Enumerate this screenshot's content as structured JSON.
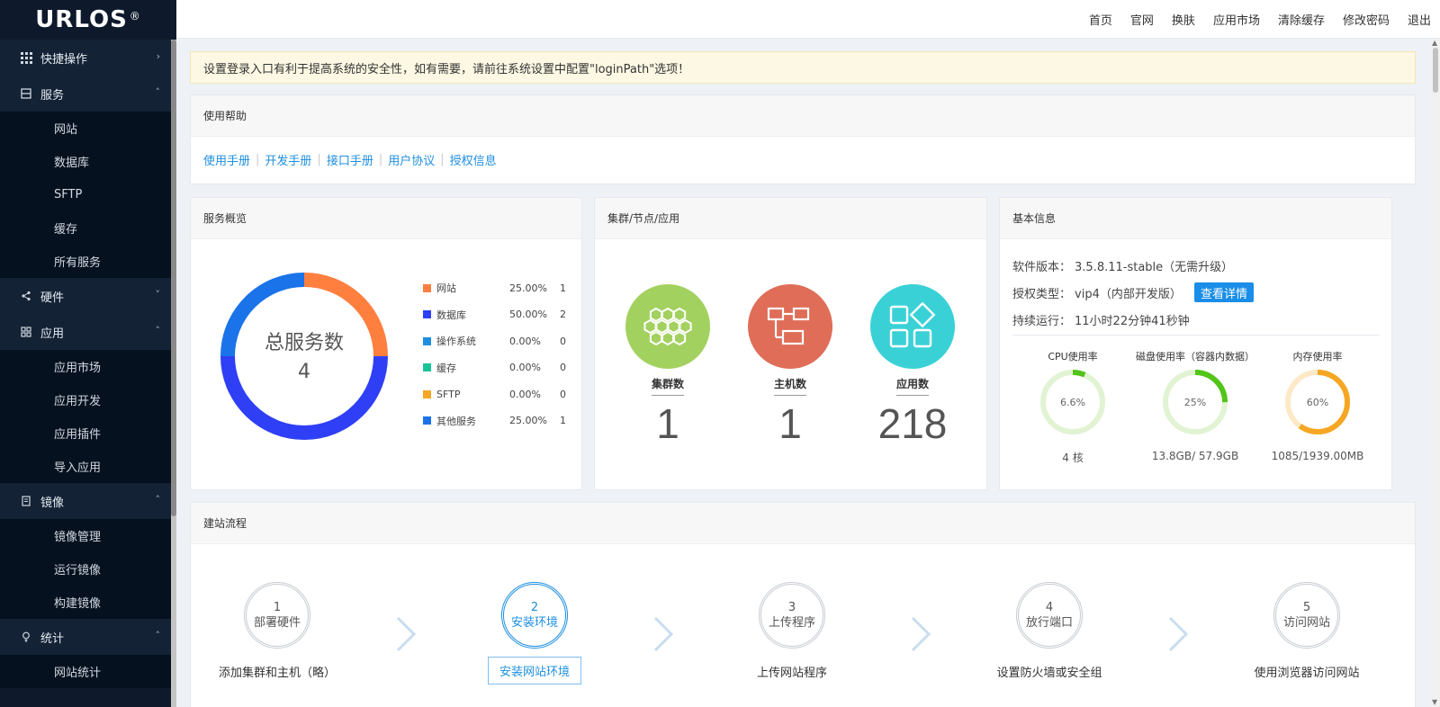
{
  "brand": {
    "name": "URLOS",
    "mark": "®"
  },
  "sidebar": {
    "groups": [
      {
        "label": "快捷操作",
        "icon": "grid-icon",
        "arrow": "›",
        "items": []
      },
      {
        "label": "服务",
        "icon": "server-icon",
        "arrow": "˄",
        "items": [
          "网站",
          "数据库",
          "SFTP",
          "缓存",
          "所有服务"
        ]
      },
      {
        "label": "硬件",
        "icon": "share-nodes-icon",
        "arrow": "˅",
        "items": []
      },
      {
        "label": "应用",
        "icon": "apps-icon",
        "arrow": "˄",
        "items": [
          "应用市场",
          "应用开发",
          "应用插件",
          "导入应用"
        ]
      },
      {
        "label": "镜像",
        "icon": "document-icon",
        "arrow": "˄",
        "items": [
          "镜像管理",
          "运行镜像",
          "构建镜像"
        ]
      },
      {
        "label": "统计",
        "icon": "lightbulb-icon",
        "arrow": "˄",
        "items": [
          "网站统计"
        ]
      }
    ]
  },
  "topnav": [
    "首页",
    "官网",
    "换肤",
    "应用市场",
    "清除缓存",
    "修改密码",
    "退出"
  ],
  "alert": "设置登录入口有利于提高系统的安全性，如有需要，请前往系统设置中配置\"loginPath\"选项！",
  "help": {
    "title": "使用帮助",
    "links": [
      "使用手册",
      "开发手册",
      "接口手册",
      "用户协议",
      "授权信息"
    ]
  },
  "services": {
    "title": "服务概览",
    "center_label": "总服务数",
    "total": "4",
    "legend": [
      {
        "name": "网站",
        "pct": "25.00%",
        "count": "1",
        "color": "#ff7f3f",
        "value": 1
      },
      {
        "name": "数据库",
        "pct": "50.00%",
        "count": "2",
        "color": "#2f3ff5",
        "value": 2
      },
      {
        "name": "操作系统",
        "pct": "0.00%",
        "count": "0",
        "color": "#1e8fe0",
        "value": 0
      },
      {
        "name": "缓存",
        "pct": "0.00%",
        "count": "0",
        "color": "#19c39a",
        "value": 0
      },
      {
        "name": "SFTP",
        "pct": "0.00%",
        "count": "0",
        "color": "#f5a623",
        "value": 0
      },
      {
        "name": "其他服务",
        "pct": "25.00%",
        "count": "1",
        "color": "#1a73e8",
        "value": 1
      }
    ]
  },
  "nodes": {
    "title": "集群/节点/应用",
    "stats": [
      {
        "label": "集群数",
        "value": "1",
        "color": "#a3d160",
        "icon": "honeycomb-icon"
      },
      {
        "label": "主机数",
        "value": "1",
        "color": "#df6d57",
        "icon": "network-hosts-icon"
      },
      {
        "label": "应用数",
        "value": "218",
        "color": "#3ad1d6",
        "icon": "app-shapes-icon"
      }
    ]
  },
  "info": {
    "title": "基本信息",
    "version_label": "软件版本：",
    "version": "3.5.8.11-stable（无需升级）",
    "license_label": "授权类型：",
    "license": "vip4（内部开发版）",
    "details_button": "查看详情",
    "uptime_label": "持续运行：",
    "uptime": "11小时22分钟41秒钟",
    "gauges": [
      {
        "title": "CPU使用率",
        "percent": 6.6,
        "text": "6.6%",
        "value": "4 核",
        "color": "#52c41a",
        "track": "#e1f3d3"
      },
      {
        "title": "磁盘使用率（容器内数据）",
        "percent": 25,
        "text": "25%",
        "value": "13.8GB/ 57.9GB",
        "color": "#52c41a",
        "track": "#e1f3d3"
      },
      {
        "title": "内存使用率",
        "percent": 60,
        "text": "60%",
        "value": "1085/1939.00MB",
        "color": "#f5a623",
        "track": "#fde9c8"
      }
    ]
  },
  "flow": {
    "title": "建站流程",
    "steps": [
      {
        "num": "1",
        "name": "部署硬件",
        "desc": "添加集群和主机（略）",
        "active": false
      },
      {
        "num": "2",
        "name": "安装环境",
        "desc": "安装网站环境",
        "active": true
      },
      {
        "num": "3",
        "name": "上传程序",
        "desc": "上传网站程序",
        "active": false
      },
      {
        "num": "4",
        "name": "放行端口",
        "desc": "设置防火墙或安全组",
        "active": false
      },
      {
        "num": "5",
        "name": "访问网站",
        "desc": "使用浏览器访问网站",
        "active": false
      }
    ]
  }
}
